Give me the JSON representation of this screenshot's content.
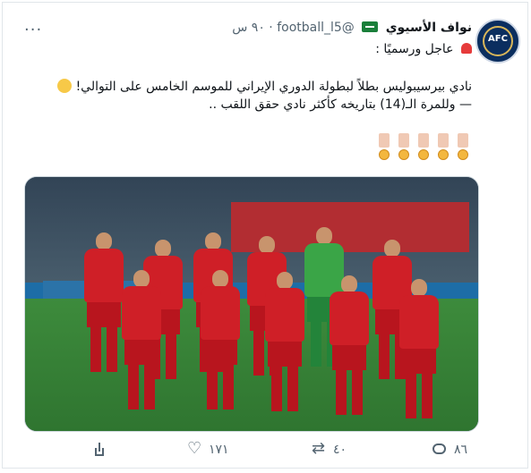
{
  "tweet": {
    "display_name": "نواف الأسيوي",
    "handle": "@football_l5",
    "timestamp": "٩٠ س",
    "more_label": "···",
    "header_line": "عاجل ورسميًا :",
    "body_line_1": "نادي بيرسيبوليس بطلاً لبطولة الدوري الإيراني للموسم الخامس على التوالي!",
    "body_line_2": "— وللمرة الـ(14) بتاريخه كأكثر نادي حقق اللقب ..",
    "avatar_text": "AFC"
  },
  "image": {
    "description_icon": "team-photo"
  },
  "actions": {
    "reply_count": "٨٦",
    "retweet_count": "٤٠",
    "like_count": "١٧١",
    "share_icon": "share-icon"
  },
  "colors": {
    "text": "#0f1419",
    "secondary": "#536471",
    "jersey": "#cf1f27"
  }
}
